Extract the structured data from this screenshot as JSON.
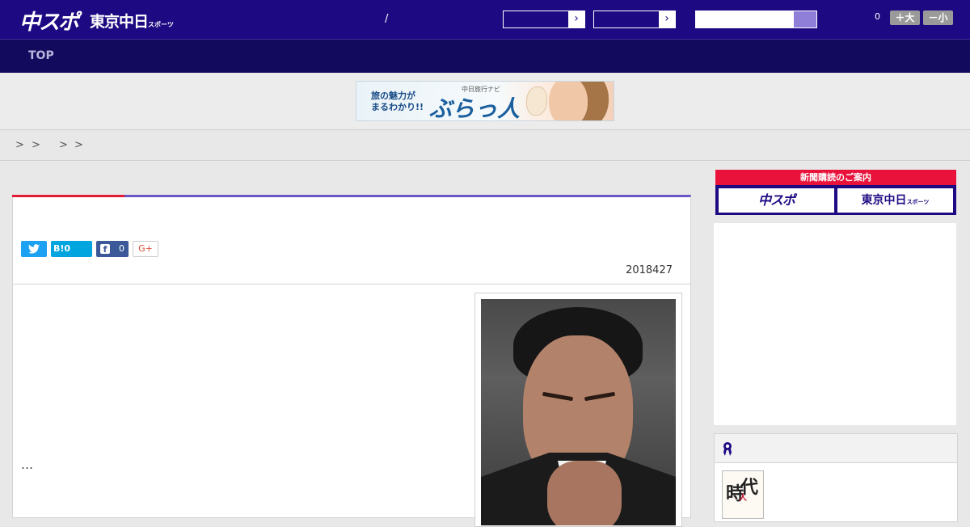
{
  "header": {
    "logo_primary": "中スポ",
    "logo_secondary": "東京中日",
    "logo_secondary_small": "スポーツ",
    "slash": "/",
    "select_arrow": "›",
    "search": {
      "value": "",
      "placeholder": ""
    },
    "count": "0",
    "font_larger_label": "＋大",
    "font_smaller_label": "－小",
    "colors": {
      "bar": "#1d0a82",
      "nav": "#120a5c",
      "accent_red": "#e21b37",
      "accent_purple": "#6a55c2"
    }
  },
  "nav": {
    "items": [
      {
        "label": "TOP"
      }
    ]
  },
  "ad_banner": {
    "line1": "旅の魅力が",
    "line2": "まるわかり!!",
    "brand_small": "中日旅行ナビ",
    "brand_large": "ぶらっ人"
  },
  "breadcrumb": {
    "separators": [
      ">",
      ">",
      ">",
      ">"
    ]
  },
  "article": {
    "share": {
      "twitter_icon": "twitter-icon",
      "hatena_label": "B!",
      "hatena_count": "0",
      "facebook_letter": "f",
      "facebook_count": "0",
      "gplus_label": "G+"
    },
    "date": "2018427",
    "body_text": "…",
    "photo_icon": "portrait-photo"
  },
  "sidebar": {
    "subscription_header": "新聞購読のご案内",
    "subscription_btn1": "中スポ",
    "subscription_btn2": "東京中日",
    "subscription_btn2_small": "スポーツ",
    "ranking_icon": "ribbon-icon",
    "thumb_chars": {
      "c1": "時",
      "c2": "代",
      "mark": "人"
    }
  }
}
